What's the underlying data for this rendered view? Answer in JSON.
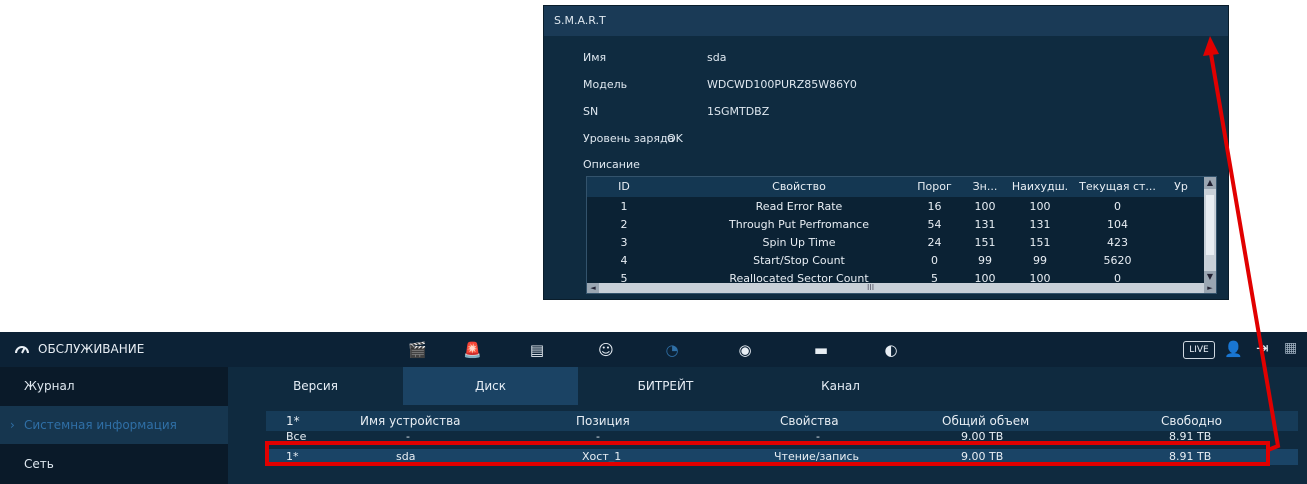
{
  "smart": {
    "title": "S.M.A.R.T",
    "fields": [
      {
        "label": "Имя",
        "value": "sda"
      },
      {
        "label": "Модель",
        "value": "WDCWD100PURZ85W86Y0"
      },
      {
        "label": "SN",
        "value": "1SGMTDBZ"
      },
      {
        "label": "Уровень заряда",
        "value": "OK"
      },
      {
        "label": "Описание",
        "value": ""
      }
    ],
    "table": {
      "headers": [
        "ID",
        "Свойство",
        "Порог",
        "Зн...",
        "Наихудш.",
        "Текущая ст...",
        "Ур"
      ],
      "rows": [
        [
          "1",
          "Read Error Rate",
          "16",
          "100",
          "100",
          "0"
        ],
        [
          "2",
          "Through Put Perfromance",
          "54",
          "131",
          "131",
          "104"
        ],
        [
          "3",
          "Spin Up Time",
          "24",
          "151",
          "151",
          "423"
        ],
        [
          "4",
          "Start/Stop Count",
          "0",
          "99",
          "99",
          "5620"
        ],
        [
          "5",
          "Reallocated Sector Count",
          "5",
          "100",
          "100",
          "0"
        ]
      ],
      "hscroll_grip": "III"
    }
  },
  "topbar": {
    "title": "ОБСЛУЖИВАНИЕ",
    "live_label": "LIVE",
    "icons": [
      "clapper-icon",
      "alarm-light-icon",
      "storage-icon",
      "support-head-icon",
      "gauge-icon",
      "target-icon",
      "monitor-icon",
      "speaker-icon"
    ]
  },
  "sidebar": {
    "items": [
      {
        "label": "Журнал"
      },
      {
        "label": "Системная информация"
      },
      {
        "label": "Сеть"
      }
    ]
  },
  "tabs": [
    {
      "label": "Версия"
    },
    {
      "label": "Диск"
    },
    {
      "label": "БИТРЕЙТ"
    },
    {
      "label": "Канал"
    }
  ],
  "disk_table": {
    "headers": [
      "1*",
      "Имя устройства",
      "Позиция",
      "Свойства",
      "Общий объем",
      "Свободно"
    ],
    "rows": [
      [
        "Все",
        "-",
        "-",
        "-",
        "9.00 TB",
        "8.91 TB"
      ],
      [
        "1*",
        "sda",
        "Хост_1",
        "Чтение/запись",
        "9.00 TB",
        "8.91 TB"
      ]
    ]
  },
  "colors": {
    "annotation": "#e10000",
    "accent": "#2f6fa6"
  }
}
